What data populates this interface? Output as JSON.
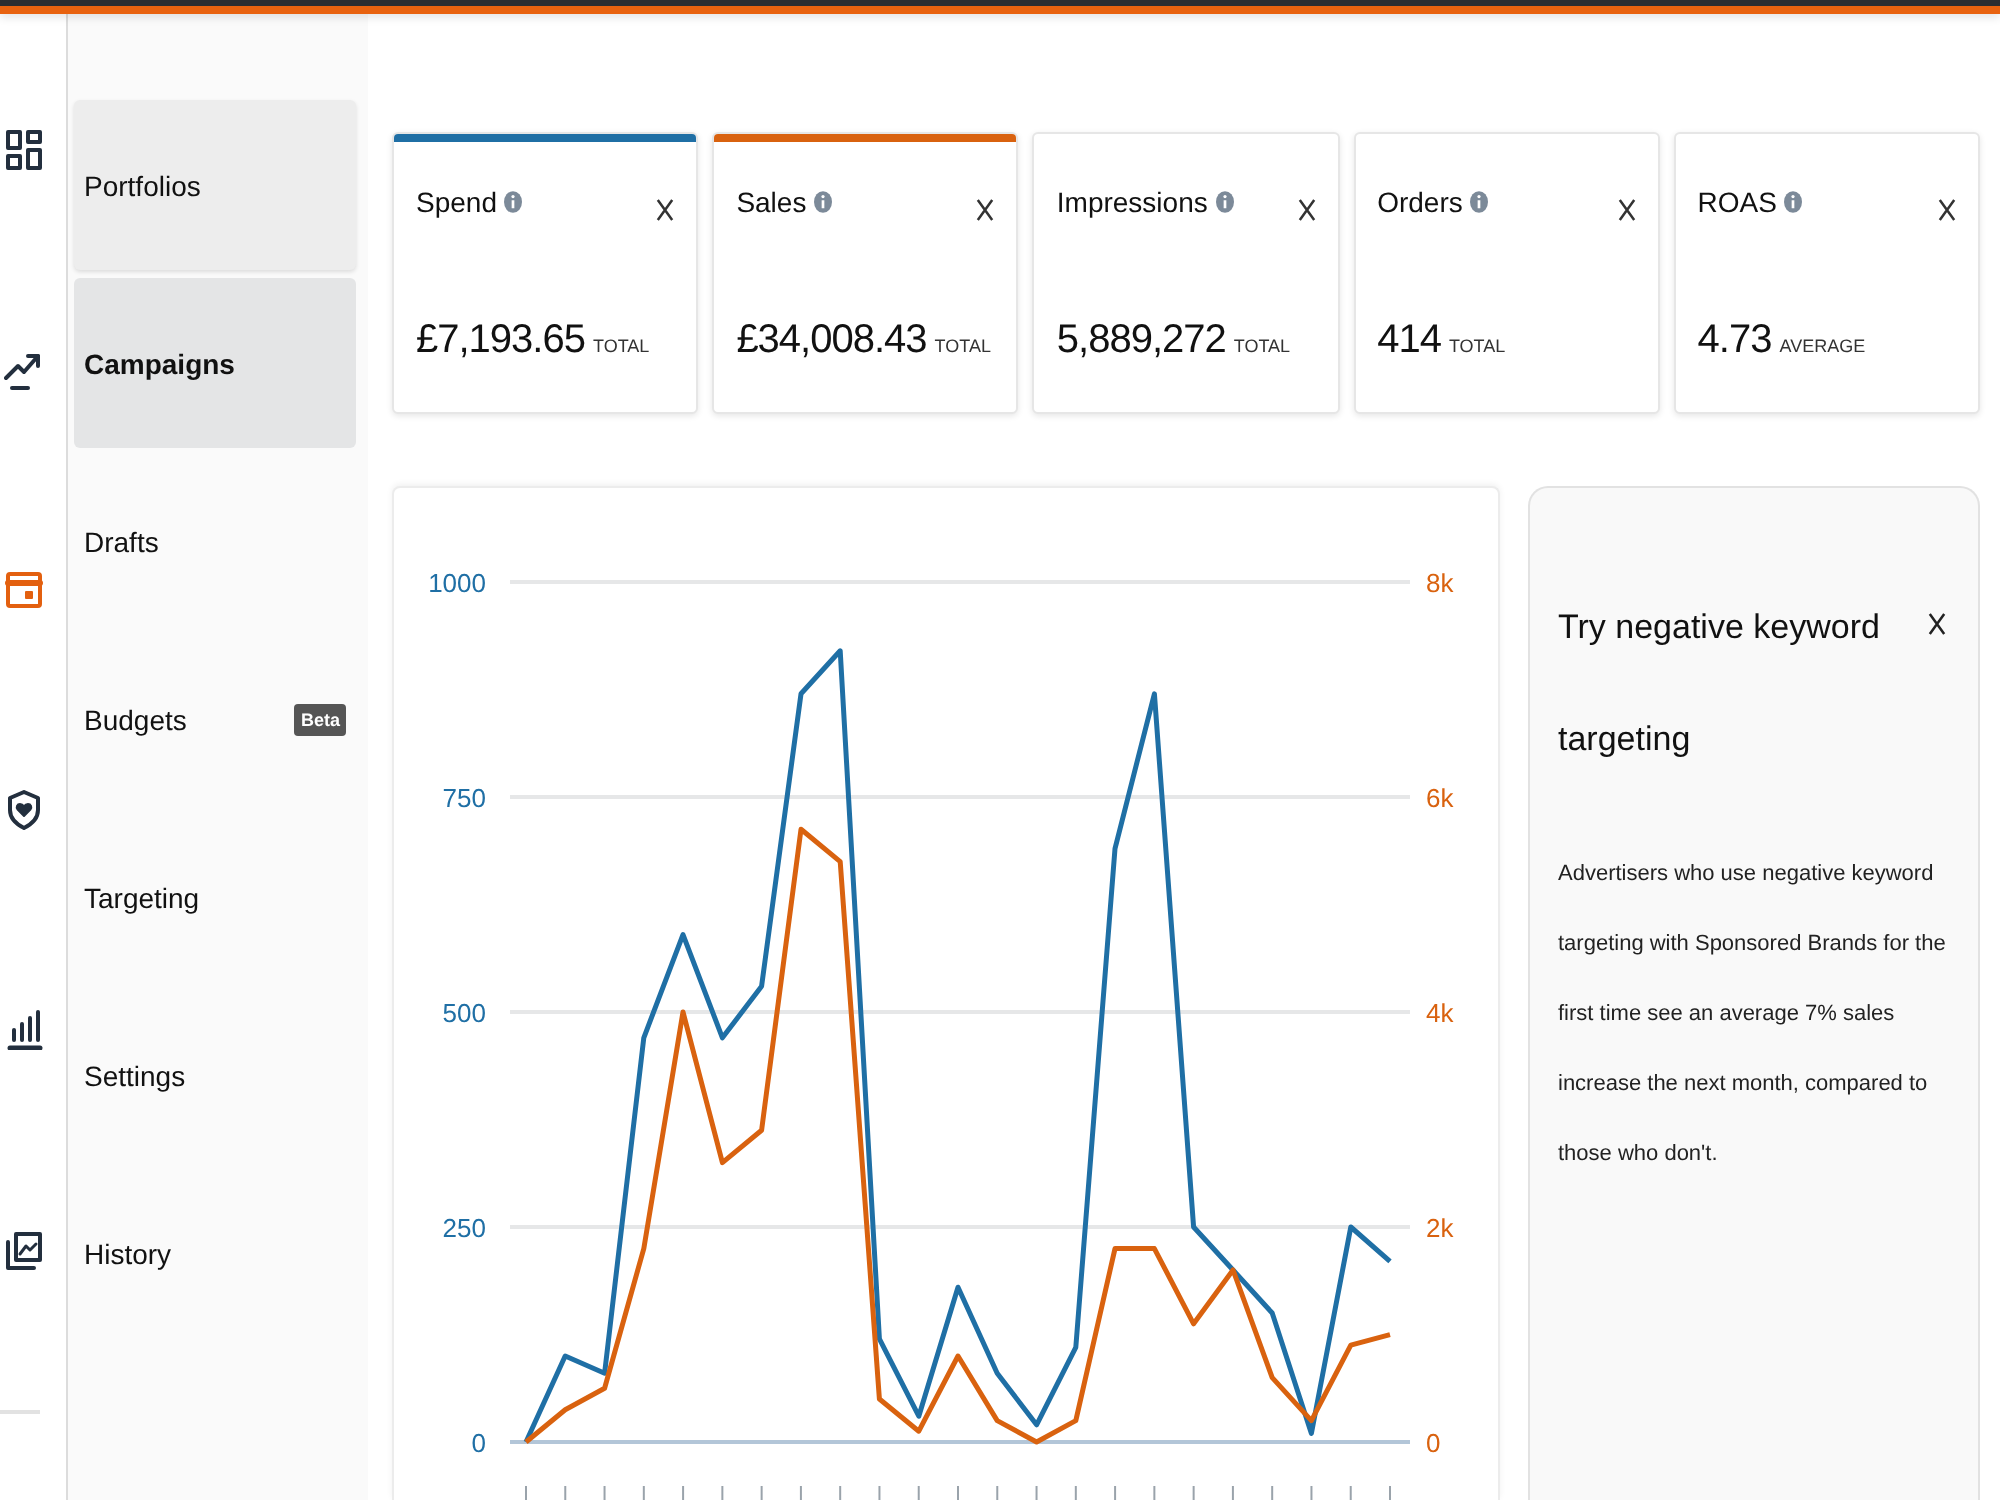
{
  "icon_rail": [
    {
      "selected": false
    },
    {
      "selected": false
    },
    {
      "selected": true
    },
    {
      "selected": false
    },
    {
      "selected": false
    },
    {
      "selected": false
    }
  ],
  "nav": {
    "items": [
      {
        "label": "Portfolios",
        "selected": false,
        "highlighted": true
      },
      {
        "label": "Campaigns",
        "selected": true,
        "highlighted": false
      },
      {
        "label": "Drafts",
        "selected": false,
        "highlighted": false
      },
      {
        "label": "Budgets",
        "badge": "Beta",
        "selected": false,
        "highlighted": false
      },
      {
        "label": "Targeting",
        "selected": false,
        "highlighted": false
      },
      {
        "label": "Settings",
        "selected": false,
        "highlighted": false
      },
      {
        "label": "History",
        "selected": false,
        "highlighted": false
      }
    ]
  },
  "metrics": [
    {
      "title": "Spend",
      "value": "£7,193.65",
      "unit": "TOTAL",
      "selected": true,
      "color": "#1f6fa5"
    },
    {
      "title": "Sales",
      "value": "£34,008.43",
      "unit": "TOTAL",
      "selected": true,
      "color": "#d9620f"
    },
    {
      "title": "Impressions",
      "value": "5,889,272",
      "unit": "TOTAL",
      "selected": false
    },
    {
      "title": "Orders",
      "value": "414",
      "unit": "TOTAL",
      "selected": false
    },
    {
      "title": "ROAS",
      "value": "4.73",
      "unit": "AVERAGE",
      "selected": false
    }
  ],
  "chart": {
    "chart_data": {
      "type": "line",
      "categories": [
        null,
        null,
        null,
        null,
        null,
        null,
        null,
        null,
        null,
        null,
        null,
        null,
        null,
        null,
        null,
        null,
        null,
        null,
        null,
        null,
        null,
        null,
        null
      ],
      "ylim": [
        0,
        1000
      ],
      "y2lim": [
        0,
        8000
      ],
      "yticks": [
        0,
        250,
        500,
        750,
        1000
      ],
      "y2ticks": [
        0,
        {
          "value": 2000,
          "label": "2k"
        },
        {
          "value": 4000,
          "label": "4k"
        },
        {
          "value": 6000,
          "label": "6k"
        },
        {
          "value": 8000,
          "label": "8k"
        }
      ],
      "grid": true,
      "series": [
        {
          "color": "#1f6fa5",
          "values": [
            0,
            100,
            80,
            470,
            590,
            470,
            530,
            870,
            920,
            120,
            30,
            180,
            80,
            20,
            110,
            690,
            870,
            250,
            200,
            150,
            10,
            250,
            210
          ]
        },
        {
          "color": "#d9620f",
          "axis": "y2",
          "values": [
            0,
            300,
            500,
            1800,
            4000,
            2600,
            2900,
            5700,
            5400,
            400,
            100,
            800,
            200,
            0,
            200,
            1800,
            1800,
            1100,
            1600,
            600,
            200,
            900,
            1000
          ]
        }
      ]
    }
  },
  "tip": {
    "title": "Try negative keyword targeting",
    "body": "Advertisers who use negative keyword targeting with Sponsored Brands for the first time see an average 7% sales increase the next month, compared to those who don't."
  }
}
